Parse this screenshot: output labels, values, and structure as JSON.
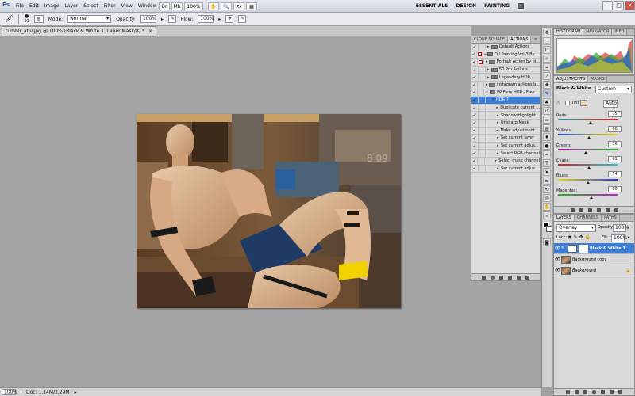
{
  "menubar": {
    "logo": "Ps",
    "items": [
      "File",
      "Edit",
      "Image",
      "Layer",
      "Select",
      "Filter",
      "View",
      "Window",
      "Help"
    ],
    "zoom": "100%",
    "workspaces": [
      "ESSENTIALS",
      "DESIGN",
      "PAINTING"
    ],
    "more": "»",
    "window_buttons": [
      "–",
      "□",
      "✕"
    ]
  },
  "options": {
    "brush_size": "91",
    "mode_label": "Mode:",
    "mode_value": "Normal",
    "opacity_label": "Opacity:",
    "opacity_value": "100%",
    "flow_label": "Flow:",
    "flow_value": "100%"
  },
  "document": {
    "tab_title": "tumblr_ativ.jpg @ 100% (Black & White 1, Layer Mask/8) *",
    "tab_close": "×"
  },
  "status": {
    "zoom": "100%",
    "doc": "Doc: 1,14M/2,29M"
  },
  "actions_panel": {
    "tabs": [
      "CLONE SOURCE",
      "ACTIONS"
    ],
    "rows": [
      {
        "label": "Default Actions",
        "type": "set",
        "red": false
      },
      {
        "label": "Oil Painting Vol-3 By ...",
        "type": "set",
        "red": true
      },
      {
        "label": "Portrait Action by pi...",
        "type": "set",
        "red": true
      },
      {
        "label": "50 Pro Actions",
        "type": "set",
        "red": false
      },
      {
        "label": "Legendary HDR",
        "type": "set",
        "red": false
      },
      {
        "label": "instagram actions b...",
        "type": "set",
        "red": false
      },
      {
        "label": "PP Faux HDR - Free ...",
        "type": "set",
        "red": false,
        "open": true
      },
      {
        "label": "HDR 7",
        "type": "action",
        "selected": true
      },
      {
        "label": "Duplicate current ...",
        "type": "step"
      },
      {
        "label": "Shadow/Highlight",
        "type": "step"
      },
      {
        "label": "Unsharp Mask",
        "type": "step"
      },
      {
        "label": "Make adjustment ...",
        "type": "step"
      },
      {
        "label": "Set current layer",
        "type": "step"
      },
      {
        "label": "Set current adjus...",
        "type": "step"
      },
      {
        "label": "Select RGB channel",
        "type": "step"
      },
      {
        "label": "Select mask channel",
        "type": "step"
      },
      {
        "label": "Set current adjus...",
        "type": "step"
      }
    ]
  },
  "histogram_panel": {
    "tabs": [
      "HISTOGRAM",
      "NAVIGATOR",
      "INFO"
    ]
  },
  "adjustments_panel": {
    "tabs": [
      "ADJUSTMENTS",
      "MASKS"
    ],
    "title": "Black & White",
    "preset": "Custom",
    "tint_label": "Tint",
    "auto_label": "Auto",
    "sliders": [
      {
        "label": "Reds:",
        "value": 75,
        "min": -200,
        "max": 300,
        "colors": [
          "#2a9c9c",
          "#d81e1e"
        ]
      },
      {
        "label": "Yellows:",
        "value": 60,
        "min": -200,
        "max": 300,
        "colors": [
          "#1f3fc9",
          "#e8d51c"
        ]
      },
      {
        "label": "Greens:",
        "value": 36,
        "min": -200,
        "max": 300,
        "colors": [
          "#b51cb5",
          "#1fb51f"
        ]
      },
      {
        "label": "Cyans:",
        "value": 61,
        "min": -200,
        "max": 300,
        "colors": [
          "#d81e1e",
          "#1ec9d8"
        ]
      },
      {
        "label": "Blues:",
        "value": 54,
        "min": -200,
        "max": 300,
        "colors": [
          "#e8d51c",
          "#1f3fc9"
        ]
      },
      {
        "label": "Magentas:",
        "value": 80,
        "min": -200,
        "max": 300,
        "colors": [
          "#1fb51f",
          "#c91cc9"
        ]
      }
    ]
  },
  "layers_panel": {
    "tabs": [
      "LAYERS",
      "CHANNELS",
      "PATHS"
    ],
    "blend_mode": "Overlay",
    "opacity_label": "Opacity:",
    "opacity_value": "100%",
    "lock_label": "Lock:",
    "fill_label": "Fill:",
    "fill_value": "100%",
    "layers": [
      {
        "name": "Black & White 1",
        "selected": true
      },
      {
        "name": "Background copy",
        "selected": false
      },
      {
        "name": "Background",
        "selected": false
      }
    ]
  }
}
